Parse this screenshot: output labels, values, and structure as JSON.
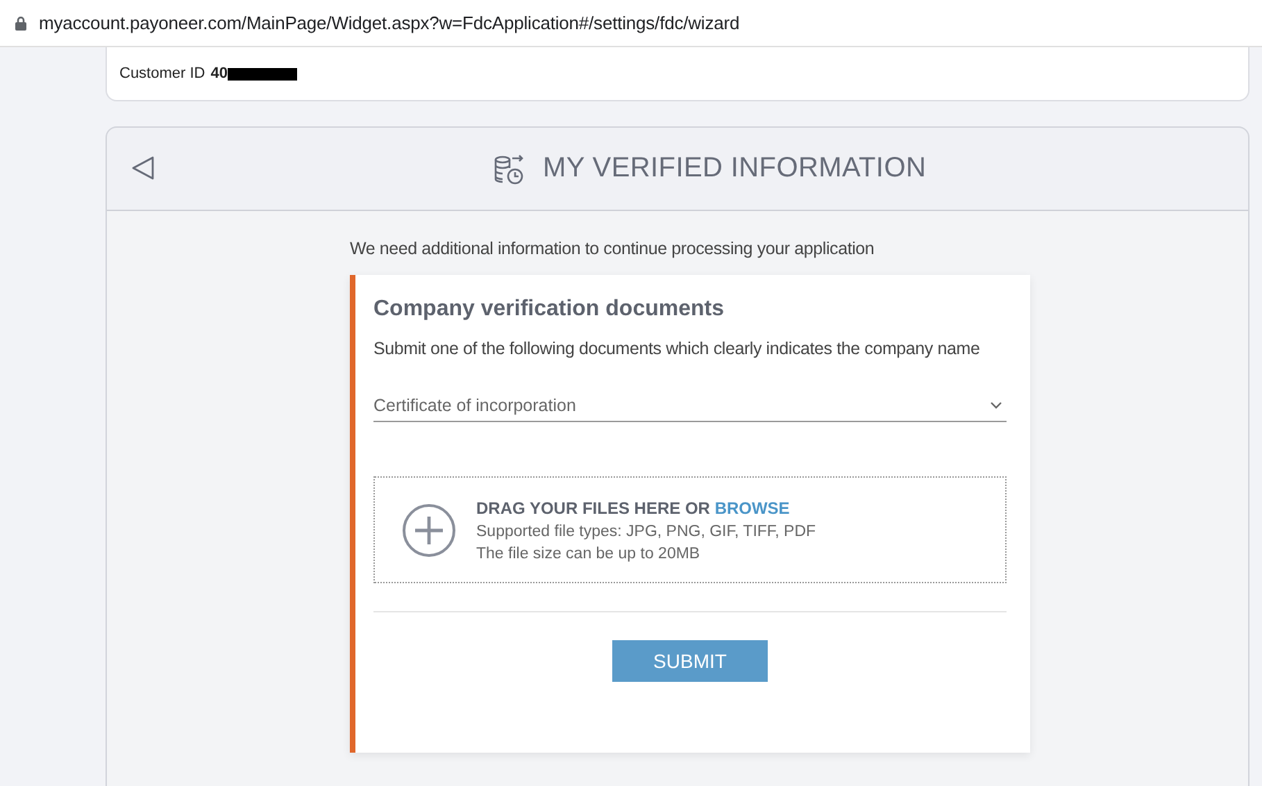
{
  "address_bar": {
    "url": "myaccount.payoneer.com/MainPage/Widget.aspx?w=FdcApplication#/settings/fdc/wizard"
  },
  "account_card": {
    "customer_id_label": "Customer ID",
    "customer_id_value": "40"
  },
  "panel": {
    "title": "MY VERIFIED INFORMATION",
    "intro": "We need additional information to continue processing your application"
  },
  "form": {
    "title": "Company verification documents",
    "description": "Submit one of the following documents which clearly indicates the company name",
    "document_select": {
      "value": "Certificate of incorporation"
    },
    "upload": {
      "prompt": "DRAG YOUR FILES HERE OR",
      "link": "BROWSE",
      "notes": [
        "Supported file types: JPG, PNG, GIF, TIFF, PDF",
        "The file size can be up to 20MB"
      ]
    },
    "submit": "SUBMIT"
  }
}
